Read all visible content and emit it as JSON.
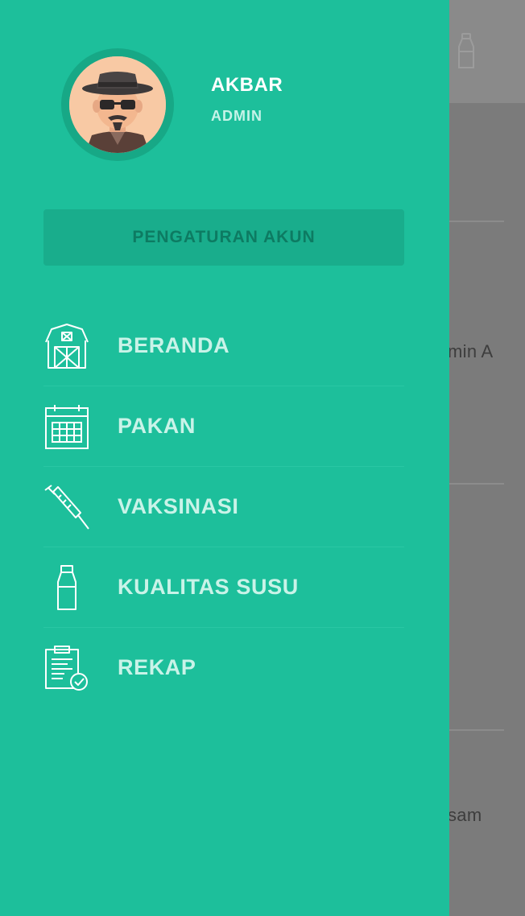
{
  "user": {
    "name": "AKBAR",
    "role": "ADMIN"
  },
  "account_button": "PENGATURAN AKUN",
  "menu": [
    {
      "label": "BERANDA",
      "icon": "barn-icon"
    },
    {
      "label": "PAKAN",
      "icon": "calendar-icon"
    },
    {
      "label": "VAKSINASI",
      "icon": "syringe-icon"
    },
    {
      "label": "KUALITAS SUSU",
      "icon": "milk-bottle-icon"
    },
    {
      "label": "REKAP",
      "icon": "clipboard-check-icon"
    }
  ],
  "background": {
    "text_1": "min A",
    "text_2": "sam"
  }
}
